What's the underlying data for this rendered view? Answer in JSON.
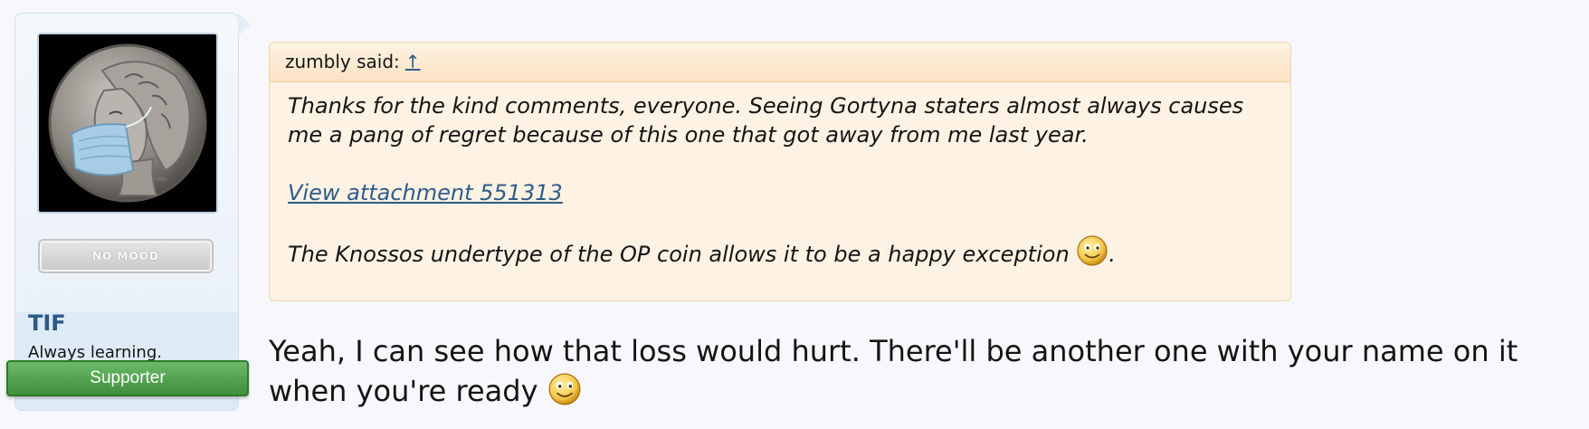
{
  "user": {
    "username": "TIF",
    "title": "Always learning.",
    "banner": "Supporter",
    "mood_label": "NO MOOD",
    "avatar_icon": "masked-coin-avatar"
  },
  "quote": {
    "author_said": "zumbly said:",
    "up_arrow": "↑",
    "line1": "Thanks for the kind comments, everyone. Seeing Gortyna staters almost always causes",
    "line2": "me a pang of regret because of this one that got away from me last year.",
    "attachment_link": "View attachment 551313",
    "line3": "The Knossos undertype of the OP coin allows it to be a happy exception",
    "line3_end": ".",
    "smiley_icon": "smile-icon"
  },
  "message": {
    "line1": "Yeah, I can see how that loss would hurt. There'll be another one with your name on it",
    "line2": "when you're ready",
    "smiley_icon": "smile-icon"
  },
  "colors": {
    "username": "#2b5b86",
    "link": "#2f5c8a",
    "banner": "#4f9f4c",
    "quote_bg": "#fdf2e3"
  }
}
